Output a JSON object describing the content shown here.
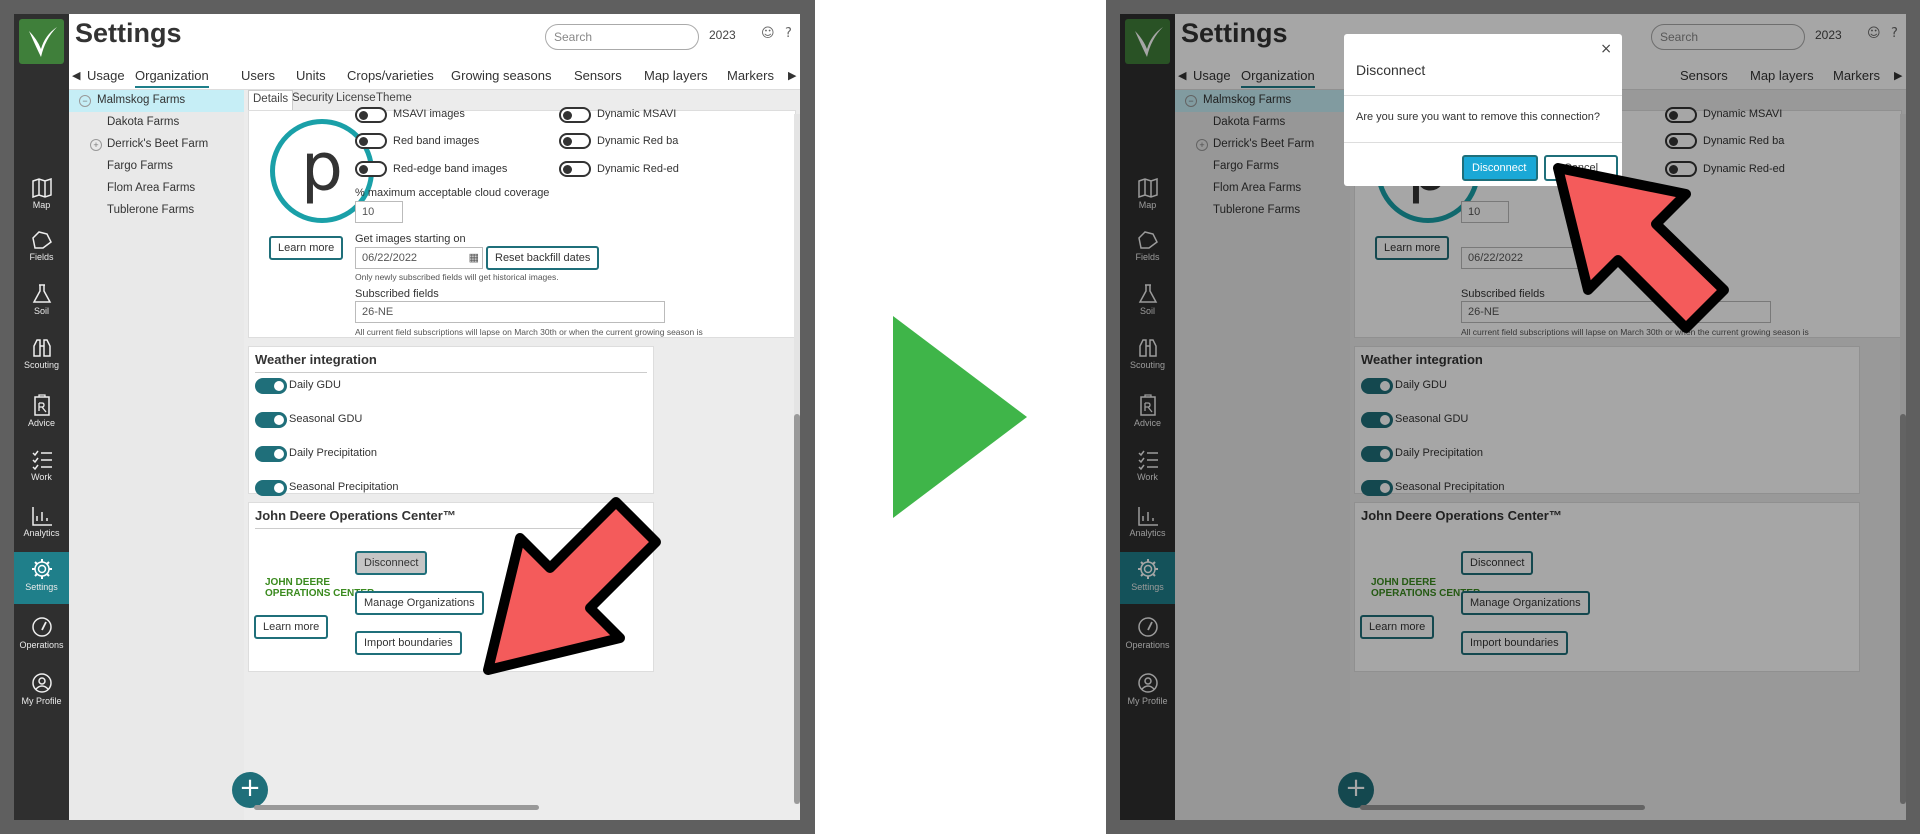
{
  "app": {
    "title": "Settings",
    "search_placeholder": "Search",
    "year": "2023"
  },
  "nav": [
    {
      "label": "Map",
      "icon": "map-icon"
    },
    {
      "label": "Fields",
      "icon": "fields-icon"
    },
    {
      "label": "Soil",
      "icon": "flask-icon"
    },
    {
      "label": "Scouting",
      "icon": "binoculars-icon"
    },
    {
      "label": "Advice",
      "icon": "prescription-icon"
    },
    {
      "label": "Work",
      "icon": "checklist-icon"
    },
    {
      "label": "Analytics",
      "icon": "chart-icon"
    },
    {
      "label": "Settings",
      "icon": "gear-icon",
      "active": true
    },
    {
      "label": "Operations",
      "icon": "gauge-icon"
    },
    {
      "label": "My Profile",
      "icon": "user-icon"
    }
  ],
  "tabs": [
    "Usage",
    "Organization",
    "Users",
    "Units",
    "Crops/varieties",
    "Growing seasons",
    "Sensors",
    "Map layers",
    "Markers"
  ],
  "active_tab": "Organization",
  "tree": [
    "Malmskog Farms",
    "Dakota Farms",
    "Derrick's Beet Farm",
    "Fargo Farms",
    "Flom Area Farms",
    "Tublerone Farms"
  ],
  "subtabs": [
    "Details",
    "Security",
    "License",
    "Theme"
  ],
  "imagery": {
    "logo_letter": "p",
    "learn_more": "Learn more",
    "toggles_left": [
      "MSAVI images",
      "Red band images",
      "Red-edge band images"
    ],
    "toggles_right": [
      "Dynamic MSAVI",
      "Dynamic Red ba",
      "Dynamic Red-ed"
    ],
    "cloud_label": "% maximum acceptable cloud coverage",
    "cloud_value": "10",
    "start_label": "Get images starting on",
    "start_value": "06/22/2022",
    "reset_button": "Reset backfill dates",
    "start_note": "Only newly subscribed fields will get historical images.",
    "fields_label": "Subscribed fields",
    "fields_value": "26-NE",
    "lapse_note": "All current field subscriptions will lapse on March 30th or when the current growing season is"
  },
  "weather": {
    "title": "Weather integration",
    "items": [
      "Daily GDU",
      "Seasonal GDU",
      "Daily Precipitation",
      "Seasonal Precipitation"
    ]
  },
  "jd": {
    "title": "John Deere Operations Center™",
    "logo_line1": "JOHN DEERE",
    "logo_line2": "OPERATIONS CENTER",
    "learn_more": "Learn more",
    "disconnect": "Disconnect",
    "manage": "Manage Organizations",
    "import": "Import boundaries"
  },
  "fab": "+",
  "dialog": {
    "title": "Disconnect",
    "close": "×",
    "body": "Are you sure you want to remove this connection?",
    "confirm": "Disconnect",
    "cancel": "Cancel"
  },
  "colors": {
    "teal": "#1f6f7a",
    "arrow_red": "#f45b5b",
    "transition_green": "#3fb549"
  }
}
